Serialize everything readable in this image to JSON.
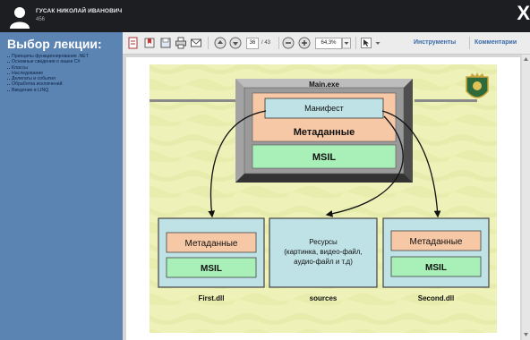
{
  "user": {
    "name": "ГУСАК НИКОЛАЙ ИВАНОВИЧ",
    "id": "456"
  },
  "window": {
    "close_symbol": "X"
  },
  "sidebar": {
    "title": "Выбор лекции:",
    "items": [
      {
        "label": "Принципы функционирования .NET"
      },
      {
        "label": "Основные сведения о языке C#"
      },
      {
        "label": "Классы"
      },
      {
        "label": "Наследование"
      },
      {
        "label": "Делегаты и события"
      },
      {
        "label": "Обработка исключений"
      },
      {
        "label": "Введение в LINQ"
      }
    ]
  },
  "toolbar": {
    "current_page": "36",
    "total_pages": "/ 43",
    "zoom": "64,3%",
    "tools_label": "Инструменты",
    "comments_label": "Комментарии",
    "icons": [
      "create-pdf-icon",
      "bookmark-icon",
      "save-icon",
      "print-icon",
      "email-icon",
      "page-up-icon",
      "page-down-icon",
      "zoom-out-icon",
      "zoom-in-icon",
      "select-tool-icon"
    ]
  },
  "slide": {
    "main_title": "Main.exe",
    "manifest": "Манифест",
    "metadata": "Метаданные",
    "msil": "MSIL",
    "first_caption": "First.dll",
    "sources_caption": "sources",
    "second_caption": "Second.dll",
    "resources_line1": "Ресурсы",
    "resources_line2": "(картинка, видео-файл,",
    "resources_line3": "аудио-файл и т.д)",
    "colors": {
      "background": "#eef2b8",
      "metadata_fill": "#f7c8a6",
      "msil_fill": "#a8f0b8",
      "box_fill": "#bfe2e6",
      "frame_gray": "#8f8f8f"
    }
  }
}
